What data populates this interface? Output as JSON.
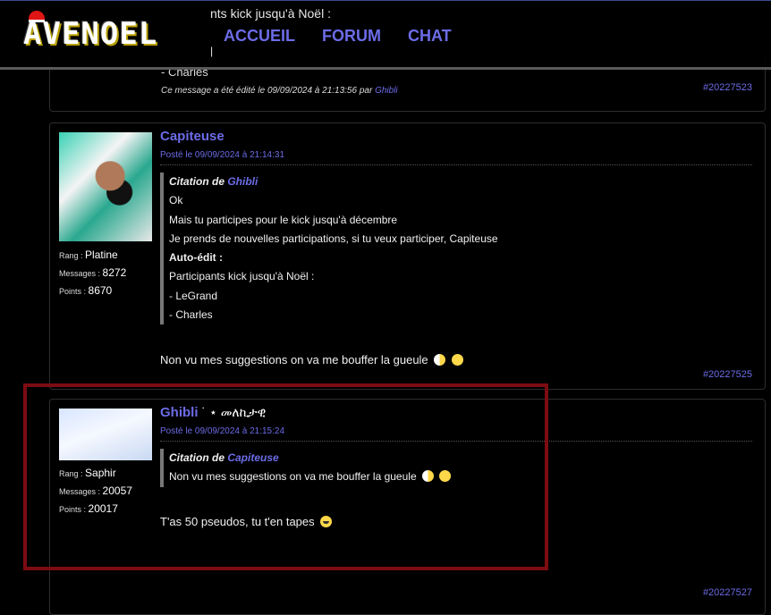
{
  "header": {
    "logo_text": "AVENOEL",
    "behind_text_1": "nts kick jusqu'à Noël :",
    "behind_text_2": "|",
    "nav": [
      {
        "label": "ACCUEIL"
      },
      {
        "label": "FORUM"
      },
      {
        "label": "CHAT"
      }
    ]
  },
  "prev_post": {
    "line": "- Charles",
    "edit_prefix": "Ce message a été édité le 09/09/2024 à 21:13:56 par",
    "edit_by": "Ghibli",
    "id": "#20227523"
  },
  "posts": [
    {
      "author": "Capiteuse",
      "author_suffix": "",
      "date": "Posté le 09/09/2024 à 21:14:31",
      "rank_key": "Rang",
      "rank": "Platine",
      "messages_key": "Messages",
      "messages": "8272",
      "points_key": "Points",
      "points": "8670",
      "quote": {
        "header": "Citation de",
        "author": "Ghibli",
        "lines": [
          "Ok",
          "Mais tu participes pour le kick jusqu'à décembre",
          "Je prends de nouvelles participations, si tu veux participer, Capiteuse",
          "Auto-édit :",
          "Participants kick jusqu'à Noël :",
          "- LeGrand",
          "- Charles"
        ]
      },
      "body": "Non vu mes suggestions on va me bouffer la gueule",
      "id": "#20227525"
    },
    {
      "author": "Ghibli",
      "author_suffix": "˙ ⋆ መለኪታዊ",
      "date": "Posté le 09/09/2024 à 21:15:24",
      "rank_key": "Rang",
      "rank": "Saphir",
      "messages_key": "Messages",
      "messages": "20057",
      "points_key": "Points",
      "points": "20017",
      "quote": {
        "header": "Citation de",
        "author": "Capiteuse",
        "lines": [
          "Non vu mes suggestions on va me bouffer la gueule"
        ]
      },
      "body": "T'as 50 pseudos, tu t'en tapes",
      "id": "#20227527"
    }
  ],
  "colors": {
    "link": "#6c6ce8",
    "highlight": "#7b0c12",
    "border": "#2e2e2e"
  }
}
